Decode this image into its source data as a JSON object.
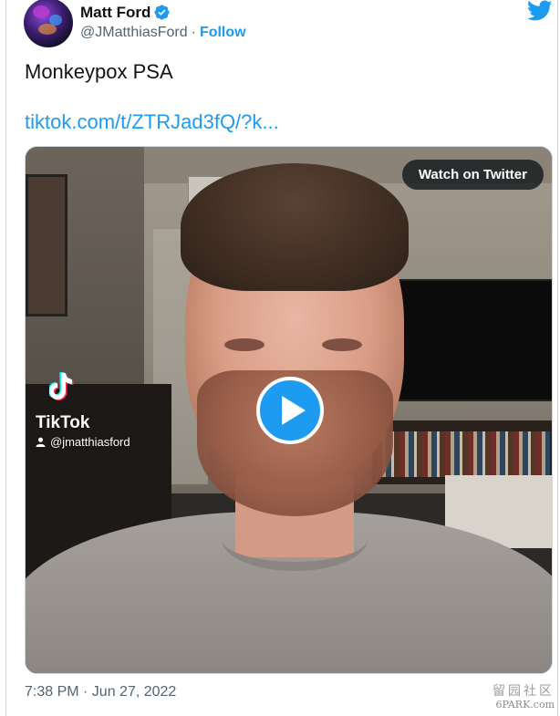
{
  "author": {
    "display_name": "Matt Ford",
    "handle": "@JMatthiasFord",
    "separator": "·",
    "follow_label": "Follow",
    "verified": true
  },
  "tweet": {
    "text": "Monkeypox PSA",
    "link_text": "tiktok.com/t/ZTRJad3fQ/?k...",
    "timestamp": "7:38 PM · Jun 27, 2022"
  },
  "media": {
    "watch_label": "Watch on Twitter",
    "tiktok_brand": "TikTok",
    "tiktok_user": "@jmatthiasford"
  },
  "icons": {
    "twitter": "twitter-bird-icon",
    "verified": "verified-badge-icon",
    "play": "play-icon",
    "tiktok": "tiktok-logo-icon",
    "person": "person-icon"
  },
  "colors": {
    "accent": "#1d9bf0",
    "secondary_text": "#536471",
    "primary_text": "#0f1419"
  },
  "watermark": {
    "cn": "留园社区",
    "en": "6PARK.com"
  }
}
